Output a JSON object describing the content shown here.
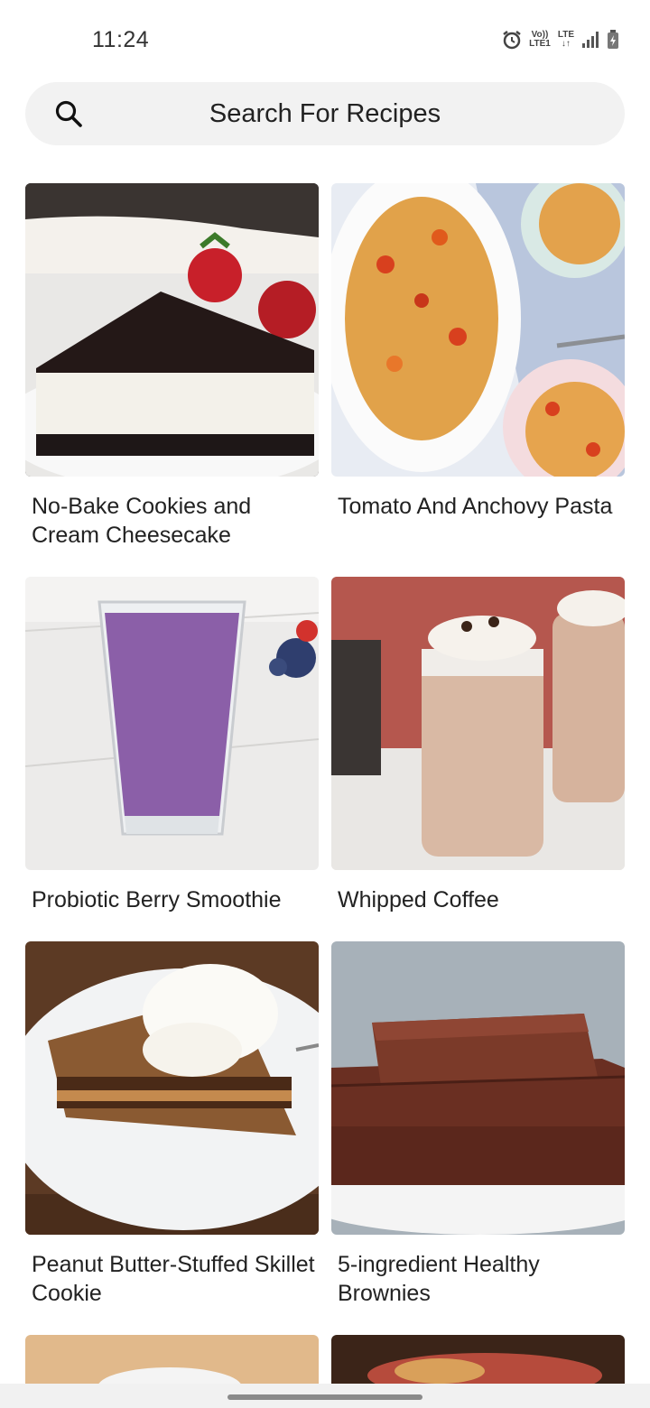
{
  "status_bar": {
    "time": "11:24",
    "volte_label": "Vo))",
    "lte1_label": "LTE1",
    "lte_label": "LTE",
    "icons": [
      "alarm-icon",
      "volte-icon",
      "lte-icon",
      "signal-icon",
      "battery-charging-icon"
    ]
  },
  "search": {
    "placeholder": "Search For Recipes",
    "icon": "search-icon"
  },
  "recipes": [
    {
      "title": "No-Bake Cookies and Cream Cheesecake",
      "image": "cheesecake-slice-photo"
    },
    {
      "title": "Tomato And Anchovy Pasta",
      "image": "spaghetti-tomato-photo"
    },
    {
      "title": "Probiotic Berry Smoothie",
      "image": "berry-smoothie-glass-photo"
    },
    {
      "title": "Whipped Coffee",
      "image": "whipped-coffee-jars-photo"
    },
    {
      "title": "Peanut Butter-Stuffed Skillet Cookie",
      "image": "skillet-cookie-icecream-photo"
    },
    {
      "title": "5-ingredient Healthy Brownies",
      "image": "stacked-brownies-photo"
    }
  ],
  "colors": {
    "background": "#ffffff",
    "search_bg": "#f2f2f2",
    "text": "#222222"
  }
}
